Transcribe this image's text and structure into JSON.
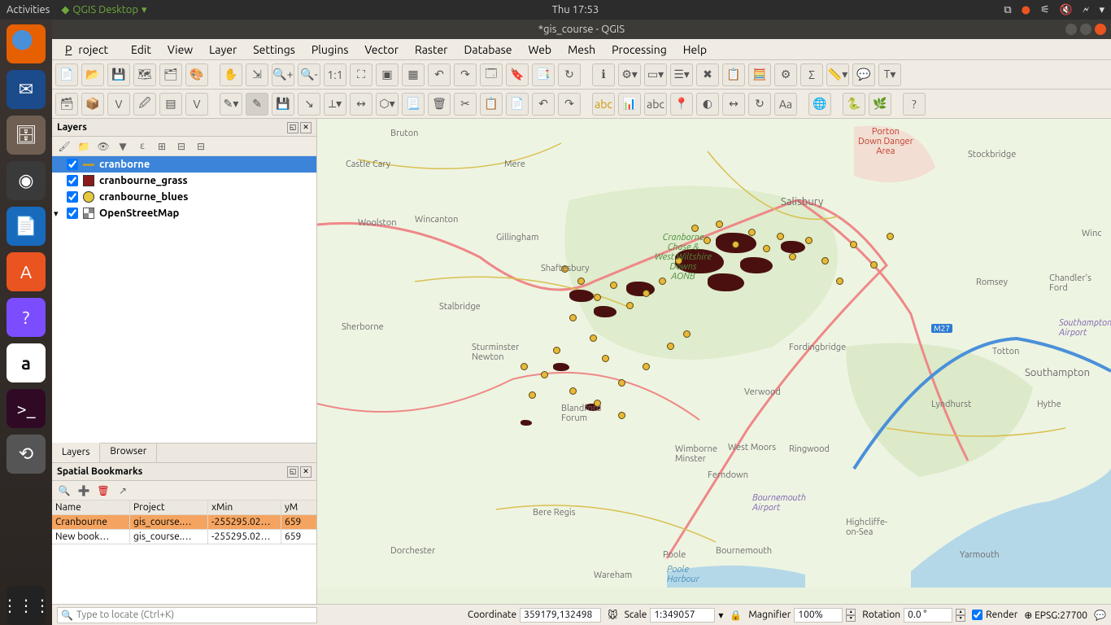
{
  "ubuntu": {
    "activities": "Activities",
    "app_name": "QGIS Desktop",
    "clock": "Thu 17:53"
  },
  "window": {
    "title": "*gis_course - QGIS"
  },
  "menu": {
    "project": "Project",
    "edit": "Edit",
    "view": "View",
    "layer": "Layer",
    "settings": "Settings",
    "plugins": "Plugins",
    "vector": "Vector",
    "raster": "Raster",
    "database": "Database",
    "web": "Web",
    "mesh": "Mesh",
    "processing": "Processing",
    "help": "Help"
  },
  "panels": {
    "layers_title": "Layers",
    "tabs": {
      "layers": "Layers",
      "browser": "Browser"
    },
    "bookmarks_title": "Spatial Bookmarks"
  },
  "layers": [
    {
      "name": "cranborne",
      "checked": true,
      "symbol": "line",
      "selected": true
    },
    {
      "name": "cranbourne_grass",
      "checked": true,
      "symbol": "poly"
    },
    {
      "name": "cranbourne_blues",
      "checked": true,
      "symbol": "point"
    },
    {
      "name": "OpenStreetMap",
      "checked": true,
      "symbol": "osm",
      "group": true
    }
  ],
  "bookmarks": {
    "headers": {
      "name": "Name",
      "project": "Project",
      "xmin": "xMin",
      "ymin": "yM"
    },
    "rows": [
      {
        "name": "Cranbourne",
        "project": "gis_course.…",
        "xmin": "-255295.02…",
        "ymin": "659",
        "selected": true
      },
      {
        "name": "New book…",
        "project": "gis_course.…",
        "xmin": "-255295.02…",
        "ymin": "659"
      }
    ]
  },
  "status": {
    "locator_placeholder": "Type to locate (Ctrl+K)",
    "coord_label": "Coordinate",
    "coord": "359179,132498",
    "scale_label": "Scale",
    "scale": "1:349057",
    "mag_label": "Magnifier",
    "mag": "100%",
    "rot_label": "Rotation",
    "rot": "0.0 °",
    "render": "Render",
    "crs": "EPSG:27700"
  },
  "map_labels": {
    "bruton": "Bruton",
    "castle_cary": "Castle Cary",
    "mere": "Mere",
    "woolston": "Woolston",
    "wincanton": "Wincanton",
    "gillingham": "Gillingham",
    "shaftesbury": "Shaftesbury",
    "stalbridge": "Stalbridge",
    "sherborne": "Sherborne",
    "sturminster": "Sturminster\nNewton",
    "blandford": "Blandford\nForum",
    "dorchester": "Dorchester",
    "wareham": "Wareham",
    "poole": "Poole",
    "bournemouth": "Bournemouth",
    "wimborne": "Wimborne\nMinster",
    "ferndown": "Ferndown",
    "west_moors": "West Moors",
    "verwood": "Verwood",
    "ringwood": "Ringwood",
    "fordingbridge": "Fordingbridge",
    "salisbury": "Salisbury",
    "stockbridge": "Stockbridge",
    "winchester": "Winc",
    "romsey": "Romsey",
    "chandlers": "Chandler's\nFord",
    "southampton": "Southampton",
    "totton": "Totton",
    "hythe": "Hythe",
    "lyndhurst": "Lyndhurst",
    "highcliffe": "Highcliffe-\non-Sea",
    "yarmouth": "Yarmouth",
    "bere": "Bere Regis",
    "aonb": "Cranborne\nChase &\nWest Wiltshire\nDowns\nAONB",
    "danger": "Porton\nDown Danger\nArea",
    "m27": "M27",
    "bmth_airport": "Bournemouth\nAirport",
    "soton_airport": "Southampton\nAirport",
    "poole_harbour": "Poole\nHarbour"
  }
}
